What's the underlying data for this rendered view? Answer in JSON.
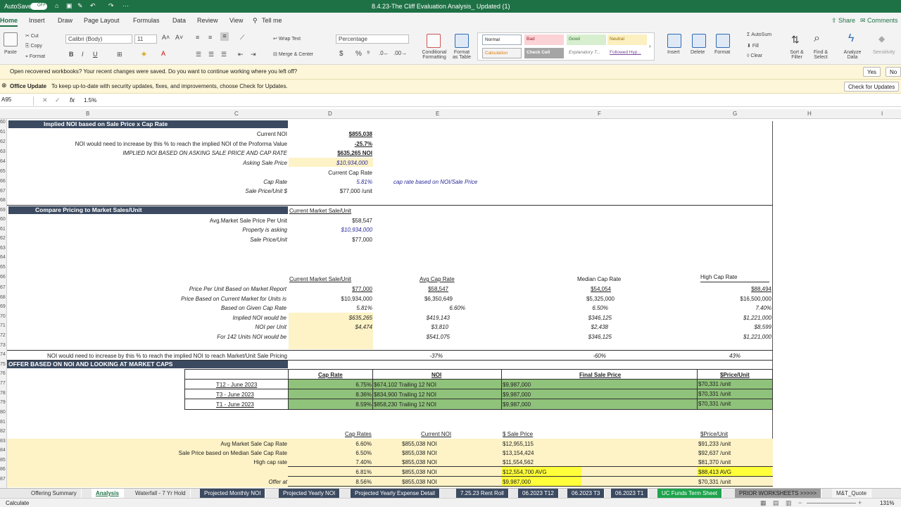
{
  "app": {
    "autosave_label": "AutoSave",
    "autosave_state": "OFF",
    "file_title": "8.4.23-The Cliff  Evaluation Analysis_ Updated (1)"
  },
  "ribbon_tabs": [
    "Home",
    "Insert",
    "Draw",
    "Page Layout",
    "Formulas",
    "Data",
    "Review",
    "View",
    "Tell me"
  ],
  "share_label": "Share",
  "comments_label": "Comments",
  "ribbon": {
    "paste": "Paste",
    "cut": "Cut",
    "copy": "Copy",
    "format": "Format",
    "font_name": "Calibri (Body)",
    "font_size": "11",
    "wrap_text": "Wrap Text",
    "merge_center": "Merge & Center",
    "number_format": "Percentage",
    "conditional": "Conditional Formatting",
    "format_table": "Format as Table",
    "styles": [
      "Normal",
      "Bad",
      "Good",
      "Neutral",
      "Calculation",
      "Check Cell",
      "Explanatory T...",
      "Followed Hyp..."
    ],
    "insert": "Insert",
    "delete": "Delete",
    "format2": "Format",
    "autosum": "AutoSum",
    "fill": "Fill",
    "clear": "Clear",
    "sort_filter": "Sort & Filter",
    "find_select": "Find & Select",
    "analyze": "Analyze Data",
    "sensitivity": "Sensitivity"
  },
  "notice1": {
    "text": "Open recovered workbooks?  Your recent changes were saved. Do you want to continue working where you left off?",
    "yes": "Yes",
    "no": "No"
  },
  "notice2": {
    "title": "Office Update",
    "text": "To keep up-to-date with security updates, fixes, and improvements, choose Check for Updates.",
    "button": "Check for Updates"
  },
  "formula_bar": {
    "name_box": "A95",
    "fx": "fx",
    "value": "1.5%"
  },
  "columns": [
    "B",
    "C",
    "D",
    "E",
    "F",
    "G",
    "H",
    "I"
  ],
  "rows": [
    "60",
    "61",
    "62",
    "63",
    "64",
    "65",
    "66",
    "67",
    "68",
    "69",
    "60",
    "61",
    "62",
    "63",
    "64",
    "65",
    "66",
    "67",
    "68",
    "69",
    "70",
    "71",
    "72",
    "73",
    "74",
    "75",
    "76",
    "77",
    "78",
    "79",
    "80",
    "81",
    "82",
    "83",
    "84",
    "85",
    "86",
    "87"
  ],
  "sec1": {
    "header": "Implied NOI based on Sale Price x Cap Rate",
    "current_noi_label": "Current NOI",
    "current_noi": "$855,038",
    "increase_label": "NOI would need to increase by this % to reach the implied NOI of the Proforma Value",
    "increase": "-25.7%",
    "implied_label": "IMPLIED NOI BASED ON ASKING SALE PRICE AND CAP RATE",
    "implied": "$635,265 NOI",
    "asking_label": "Asking Sale Price",
    "asking": "$10,934,000",
    "cur_cap_hdr": "Current Cap Rate",
    "cap_label": "Cap Rate",
    "cap": "5.81%",
    "cap_note": "cap rate based on NOI/Sale Price",
    "ppu_label": "Sale Price/Unit $",
    "ppu": "$77,000 /unit"
  },
  "sec2": {
    "header": "Compare Pricing to Market Sales/Unit",
    "col_hdr": "Current Market Sale/Unit",
    "avg_label": "Avg.Market Sale Price Per Unit",
    "avg": "$58,547",
    "asking_label": "Property is asking",
    "asking": "$10,934,000",
    "spu_label": "Sale Price/Unit",
    "spu": "$77,000"
  },
  "sec3": {
    "headers": [
      "Current Market Sale/Unit",
      "Avg Cap Rate",
      "Median Cap Rate",
      "High Cap Rate"
    ],
    "rows": [
      {
        "label": "Price Per Unit Based on Market Report",
        "vals": [
          "$77,000",
          "$58,547",
          "$54,054",
          "$88,494"
        ],
        "ul": true
      },
      {
        "label": "Price Based on Current Market for Units is",
        "vals": [
          "$10,934,000",
          "$6,350,649",
          "$5,325,000",
          "$16,500,000"
        ]
      },
      {
        "label": "Based on Given Cap Rate",
        "vals": [
          "5.81%",
          "6.60%",
          "6.50%",
          "7.40%"
        ]
      },
      {
        "label": "Implied NOI would be",
        "vals": [
          "$635,265",
          "$419,143",
          "$346,125",
          "$1,221,000"
        ]
      },
      {
        "label": "NOI per Unit",
        "vals": [
          "$4,474",
          "$3,810",
          "$2,438",
          "$8,599"
        ]
      },
      {
        "label": "For 142 Units NOI would be",
        "vals": [
          "",
          "$541,075",
          "$346,125",
          "$1,221,000"
        ]
      }
    ],
    "increase_label": "NOI would need to increase by this % to reach the implied NOI to reach Market/Unit Sale Pricing",
    "increase_vals": [
      "-37%",
      "-60%",
      "43%"
    ]
  },
  "sec4": {
    "header": "OFFER BASED ON NOI AND LOOKING AT MARKET CAPS",
    "cols": [
      "Cap Rate",
      "NOI",
      "Final Sale Price",
      "$Price/Unit"
    ],
    "rows": [
      {
        "label": "T12 - June 2023",
        "cap": "6.75%",
        "noi": "$674,102 Trailing 12 NOI",
        "price": "$9,987,000",
        "ppu": "$70,331 /unit"
      },
      {
        "label": "T3 - June 2023",
        "cap": "8.36%",
        "noi": "$834,900 Trailing 12 NOI",
        "price": "$9,987,000",
        "ppu": "$70,331 /unit"
      },
      {
        "label": "T1 - June 2023",
        "cap": "8.59%",
        "noi": "$858,230 Trailing 12 NOI",
        "price": "$9,987,000",
        "ppu": "$70,331 /unit"
      }
    ]
  },
  "sec5": {
    "cols": [
      "Cap Rates",
      "Current NOI",
      "$ Sale Price",
      "$Price/Unit"
    ],
    "rows": [
      {
        "label": "Avg Market Sale Cap Rate",
        "cap": "6.60%",
        "noi": "$855,038 NOI",
        "price": "$12,955,115",
        "ppu": "$91,233 /unit"
      },
      {
        "label": "Sale Price based on Median Sale Cap Rate",
        "cap": "6.50%",
        "noi": "$855,038 NOI",
        "price": "$13,154,424",
        "ppu": "$92,637 /unit"
      },
      {
        "label": "High cap rate",
        "cap": "7.40%",
        "noi": "$855,038 NOI",
        "price": "$11,554,562",
        "ppu": "$81,370 /unit"
      },
      {
        "label": "",
        "cap": "6.81%",
        "noi": "$855,038 NOI",
        "price": "$12,554,700 AVG",
        "ppu": "$88,413 AVG"
      },
      {
        "label": "Offer at",
        "cap": "8.56%",
        "noi": "$855,038 NOI",
        "price": "$9,987,000",
        "ppu": "$70,331 /unit"
      }
    ]
  },
  "sheet_tabs": [
    "Offering Summary",
    "Analysis",
    "Waterfall - 7 Yr Hold",
    "Projected Monthly NOI",
    "Projected Yearly NOI",
    "Projected Yearly Expense Detail",
    "7.25.23 Rent Roll",
    "06.2023 T12",
    "06.2023 T3",
    "06.2023 T1",
    "UC Funds Term Sheet",
    "PRIOR WORKSHEETS >>>>>",
    "M&T_Quote"
  ],
  "status": {
    "mode": "Calculate",
    "zoom": "131%"
  },
  "colors": {
    "excel_green": "#1e7145",
    "header_navy": "#3b4a60",
    "input_yellow": "#fdf3c7",
    "offer_green": "#8fc27a",
    "highlight_yellow": "#ffff3a"
  }
}
